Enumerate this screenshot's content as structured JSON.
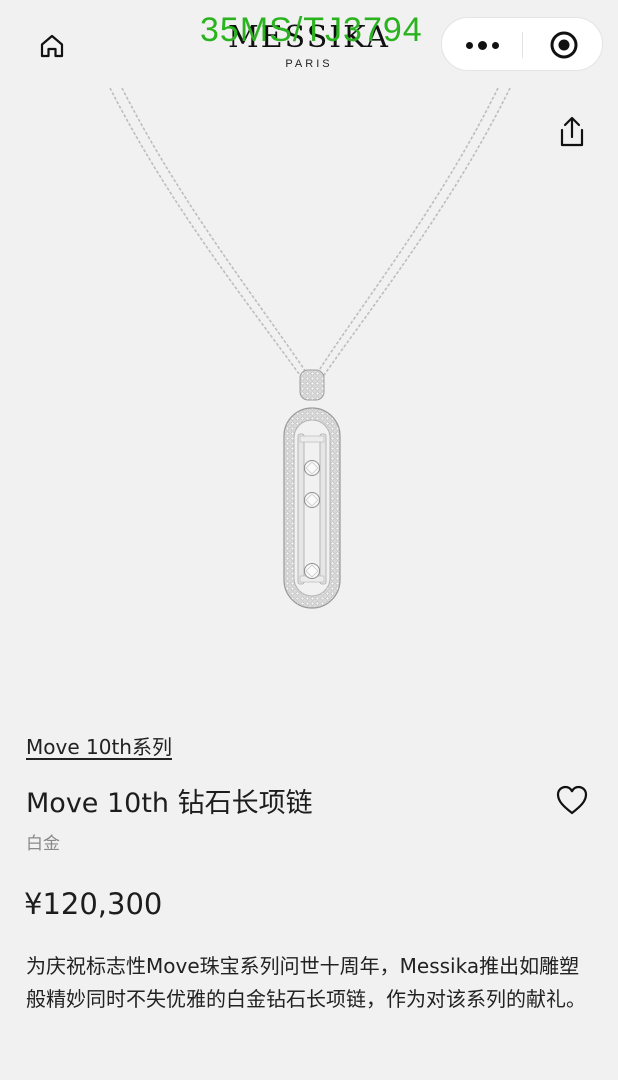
{
  "header": {
    "brand_name": "MESSIKA",
    "brand_sub": "PARIS",
    "watermark": "35MS/TJ3794",
    "icons": {
      "home": "home-icon",
      "more": "more-dots-icon",
      "close": "target-close-icon",
      "share": "share-icon",
      "favorite": "heart-icon"
    }
  },
  "product": {
    "collection_link": "Move 10th系列",
    "title": "Move 10th 钻石长项链",
    "material": "白金",
    "price": "¥120,300",
    "description": "为庆祝标志性Move珠宝系列问世十周年，Messika推出如雕塑般精妙同时不失优雅的白金钻石长项链，作为对该系列的献礼。"
  }
}
